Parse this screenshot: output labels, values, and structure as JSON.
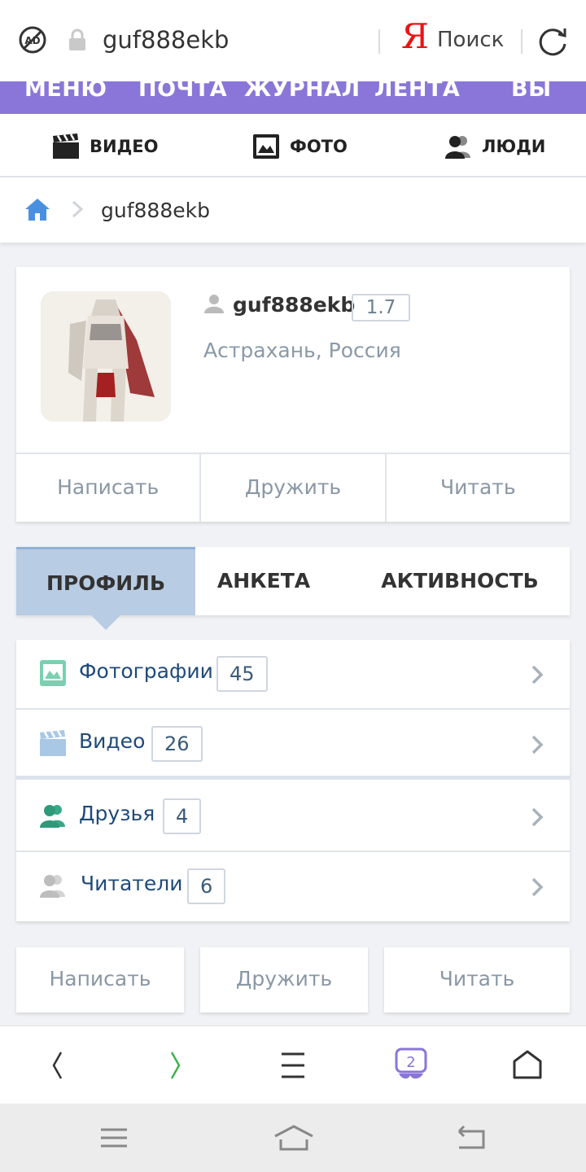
{
  "browser": {
    "url": "guf888ekb",
    "search_label": "Поиск",
    "yandex_logo": "Я",
    "tabs_count": "2"
  },
  "topnav": [
    "МЕНЮ",
    "ПОЧТА",
    "ЖУРНАЛ",
    "ЛЕНТА",
    "ВЫ"
  ],
  "medianav": {
    "video": "ВИДЕО",
    "photo": "ФОТО",
    "people": "ЛЮДИ"
  },
  "breadcrumb": {
    "current": "guf888ekb"
  },
  "profile": {
    "username": "guf888ekb",
    "rating": "1.7",
    "location": "Астрахань, Россия",
    "actions": {
      "write": "Написать",
      "friend": "Дружить",
      "read": "Читать"
    }
  },
  "tabs": {
    "profile": "ПРОФИЛЬ",
    "questionnaire": "АНКЕТА",
    "activity": "АКТИВНОСТЬ"
  },
  "stats": [
    {
      "label": "Фотографии",
      "count": "45"
    },
    {
      "label": "Видео",
      "count": "26"
    },
    {
      "label": "Друзья",
      "count": "4"
    },
    {
      "label": "Читатели",
      "count": "6"
    }
  ],
  "bottom_actions": {
    "write": "Написать",
    "friend": "Дружить",
    "read": "Читать"
  },
  "colors": {
    "menu_bar": "#8a76d8",
    "active_tab": "#b8cce3",
    "link_text": "#1f4a7a",
    "home_icon": "#4a90e2",
    "yandex_red": "#e11111"
  }
}
